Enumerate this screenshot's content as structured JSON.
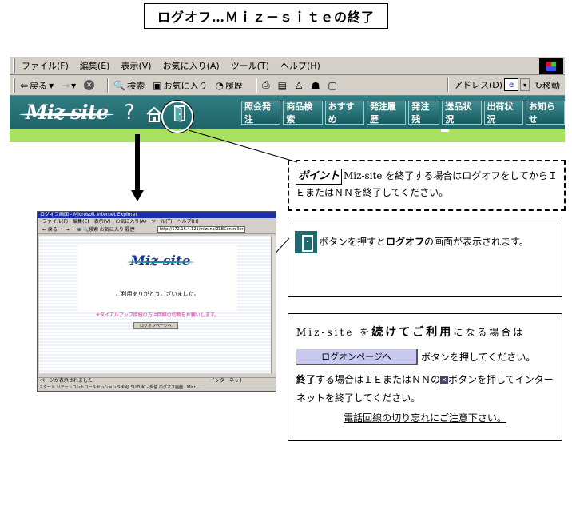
{
  "title": "ログオフ…Ｍｉｚ－ｓｉｔｅの終了",
  "browser": {
    "menu": [
      "ファイル(F)",
      "編集(E)",
      "表示(V)",
      "お気に入り(A)",
      "ツール(T)",
      "ヘルプ(H)"
    ],
    "toolbar": {
      "back": "戻る",
      "search": "検索",
      "favorites": "お気に入り",
      "history": "履歴",
      "address_label": "アドレス(D)",
      "go": "移動"
    }
  },
  "site": {
    "logo": "Miz site",
    "help_symbol": "?",
    "nav": [
      "照会発注",
      "商品検索",
      "おすすめ",
      "発注履歴",
      "発注残",
      "送品状況",
      "出荷状況",
      "お知らせ"
    ]
  },
  "point_box": {
    "label": "ポイント",
    "text": "Miz-site を終了する場合はログオフをしてからＩＥまたはＮＮを終了してください。"
  },
  "box2": {
    "text_before": "ボタンを押すと",
    "text_bold": "ログオフ",
    "text_after": "の画面が表示されます。"
  },
  "box3": {
    "lead": "Miz-site を",
    "lead_bold": "続けてご利用",
    "lead_after": "になる場合は",
    "logon_button": "ログオンページへ",
    "after_button": "ボタンを押してください。",
    "end_bold": "終了",
    "end_text1": "する場合はＩＥまたはＮＮの",
    "end_text2": "ボタンを押してインターネットを終了してください。",
    "notice": "電話回線の切り忘れにご注意下さい。"
  },
  "mini": {
    "title_bar": "ログオフ画面 - Microsoft Internet Explorer",
    "menu": "ファイル(F)　編集(E)　表示(V)　お気に入り(A)　ツール(T)　ヘルプ(H)",
    "toolbar": "← 戻る ・ → ・ ⊗ 🔍検索 お気に入り 履歴",
    "address": "http://172.16.4.121/mizuno/ZLBController",
    "logo": "Miz site",
    "thanks": "ご利用ありがとうございました。",
    "warning": "※ダイアルアップ接続の方は回線の切断をお願いします。",
    "logon_button": "ログオンページへ",
    "status": "ページが表示されました",
    "status_zone": "インターネット",
    "taskbar": "スタート  リモートコントロールセッション  SHINJI SUZUKI - 受信  ログオフ画面 - Micr..."
  }
}
